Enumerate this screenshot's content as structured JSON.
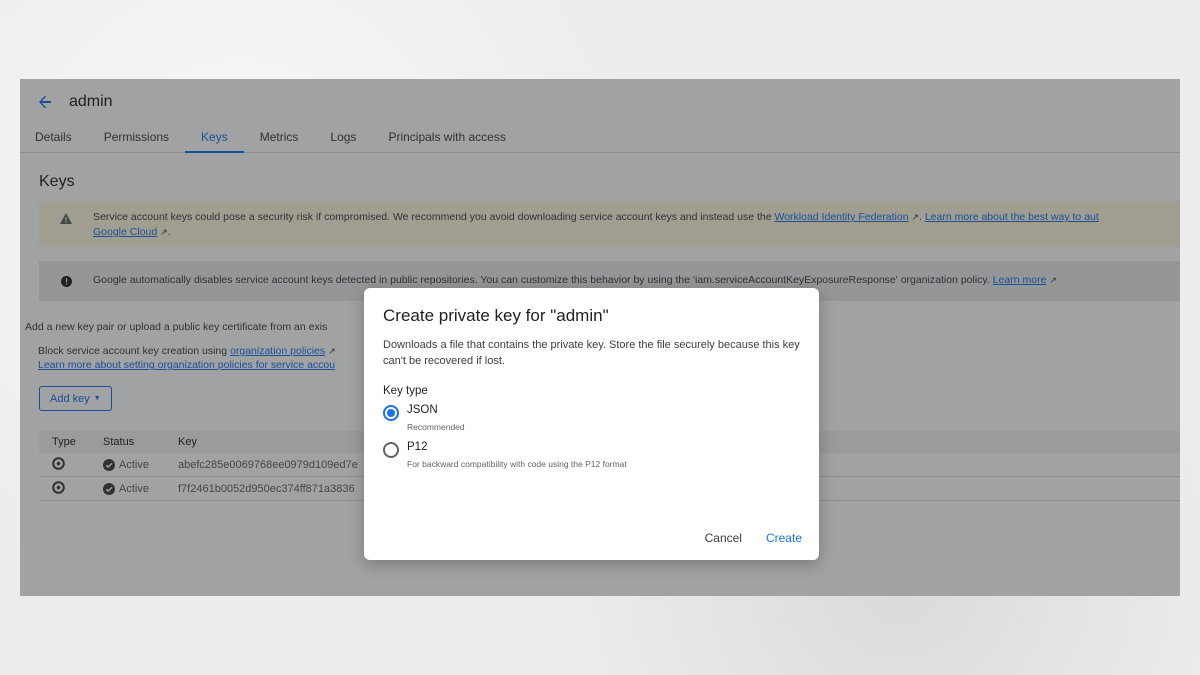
{
  "header": {
    "title": "admin"
  },
  "tabs": [
    {
      "label": "Details"
    },
    {
      "label": "Permissions"
    },
    {
      "label": "Keys",
      "active": true
    },
    {
      "label": "Metrics"
    },
    {
      "label": "Logs"
    },
    {
      "label": "Principals with access"
    }
  ],
  "keys_section": {
    "title": "Keys",
    "warning": {
      "text_1": "Service account keys could pose a security risk if compromised. We recommend you avoid downloading service account keys and instead use the ",
      "link_1": "Workload Identity Federation",
      "text_2": ". ",
      "link_2": "Learn more about the best way to aut",
      "link_3": "Google Cloud",
      "text_3": "."
    },
    "info": {
      "text": "Google automatically disables service account keys detected in public repositories. You can customize this behavior by using the 'iam.serviceAccountKeyExposureResponse' organization policy. ",
      "link": "Learn more"
    },
    "add_new_text": "Add a new key pair or upload a public key certificate from an exis",
    "block_text": "Block service account key creation using ",
    "block_link": "organization policies",
    "learn_link": "Learn more about setting organization policies for service accou",
    "add_key_label": "Add key"
  },
  "table": {
    "headers": {
      "type": "Type",
      "status": "Status",
      "key": "Key"
    },
    "rows": [
      {
        "status": "Active",
        "key": "abefc285e0069768ee0979d109ed7e"
      },
      {
        "status": "Active",
        "key": "f7f2461b0052d950ec374ff871a3836"
      }
    ]
  },
  "dialog": {
    "title": "Create private key for \"admin\"",
    "description": "Downloads a file that contains the private key. Store the file securely because this key can't be recovered if lost.",
    "key_type_label": "Key type",
    "options": [
      {
        "label": "JSON",
        "sub": "Recommended",
        "checked": true
      },
      {
        "label": "P12",
        "sub": "For backward compatibility with code using the P12 format",
        "checked": false
      }
    ],
    "cancel_label": "Cancel",
    "create_label": "Create"
  },
  "colors": {
    "accent": "#1a73e8",
    "warning_bg": "#fef7e0",
    "info_bg": "#e8eaed"
  }
}
